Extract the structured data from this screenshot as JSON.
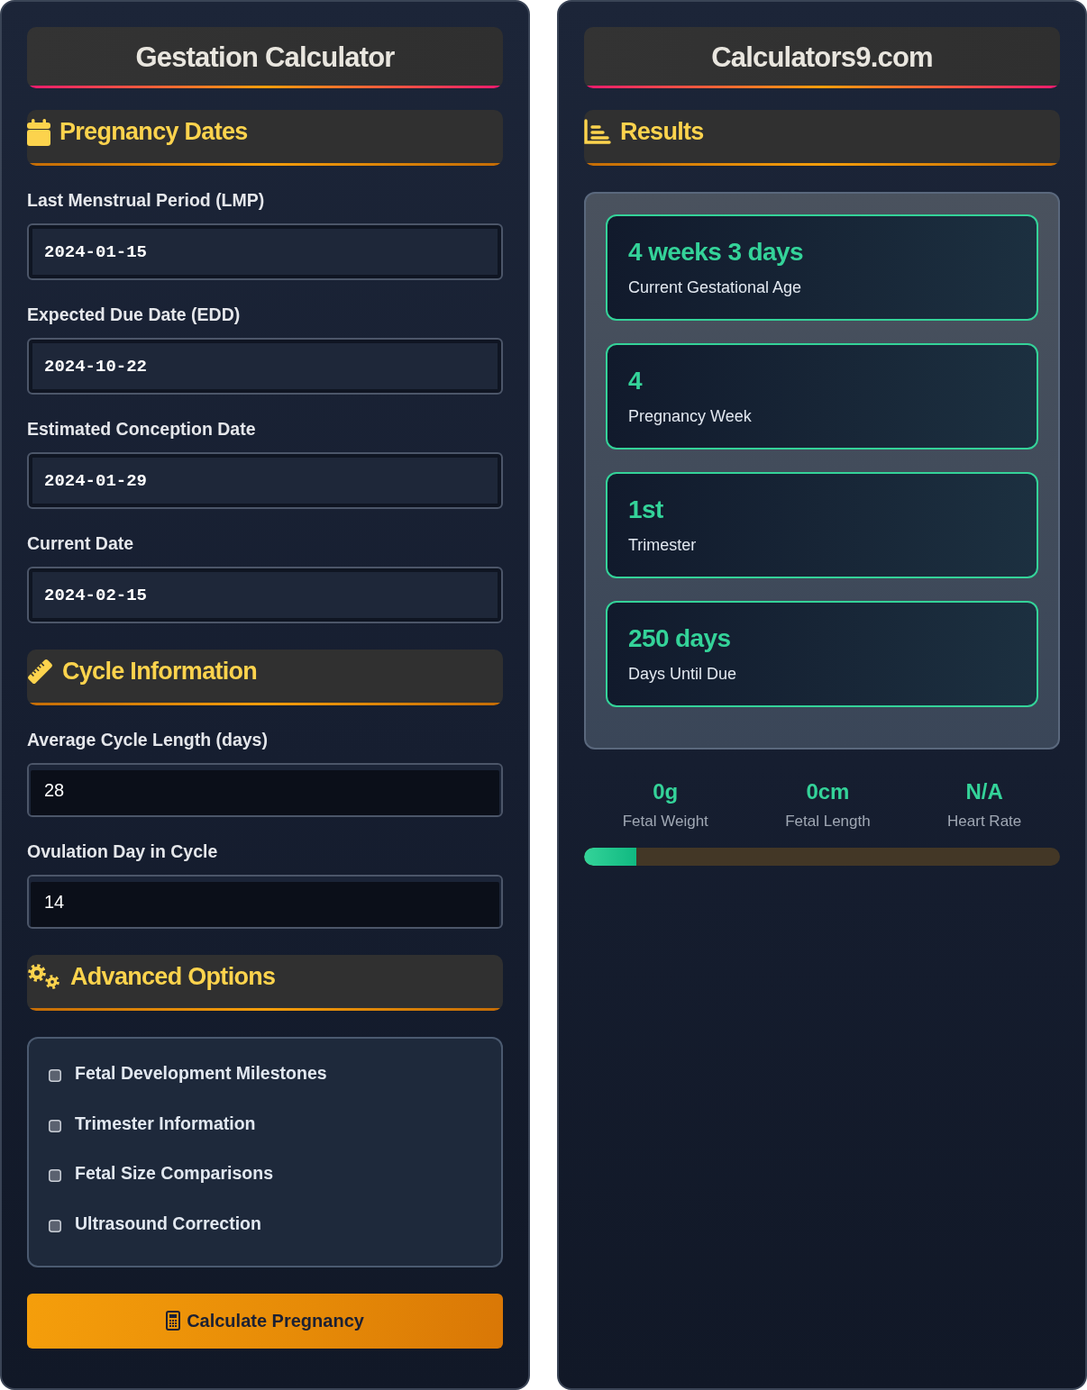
{
  "left_panel": {
    "title": "Gestation Calculator",
    "sections": [
      {
        "kind": "date_fields",
        "heading": "Pregnancy Dates",
        "fields": [
          {
            "label": "Last Menstrual Period (LMP)",
            "value": "2024-01-15"
          },
          {
            "label": "Expected Due Date (EDD)",
            "value": "2024-10-22"
          },
          {
            "label": "Estimated Conception Date",
            "value": "2024-01-29"
          },
          {
            "label": "Current Date",
            "value": "2024-02-15"
          }
        ]
      },
      {
        "kind": "number_fields",
        "heading": "Cycle Information",
        "fields": [
          {
            "label": "Average Cycle Length (days)",
            "value": "28"
          },
          {
            "label": "Ovulation Day in Cycle",
            "value": "14"
          }
        ]
      },
      {
        "kind": "checkbox_list",
        "heading": "Advanced Options",
        "options": [
          {
            "label": "Fetal Development Milestones",
            "checked": false
          },
          {
            "label": "Trimester Information",
            "checked": false
          },
          {
            "label": "Fetal Size Comparisons",
            "checked": false
          },
          {
            "label": "Ultrasound Correction",
            "checked": false
          }
        ]
      }
    ],
    "calculate_button": "Calculate Pregnancy"
  },
  "right_panel": {
    "title": "Calculators9.com",
    "heading": "Results",
    "cards": [
      {
        "value": "4 weeks 3 days",
        "label": "Current Gestational Age"
      },
      {
        "value": "4",
        "label": "Pregnancy Week"
      },
      {
        "value": "1st",
        "label": "Trimester"
      },
      {
        "value": "250 days",
        "label": "Days Until Due"
      }
    ],
    "stats": [
      {
        "value": "0g",
        "label": "Fetal Weight"
      },
      {
        "value": "0cm",
        "label": "Fetal Length"
      },
      {
        "value": "N/A",
        "label": "Heart Rate"
      }
    ],
    "progress": {
      "level": 0.11
    }
  }
}
